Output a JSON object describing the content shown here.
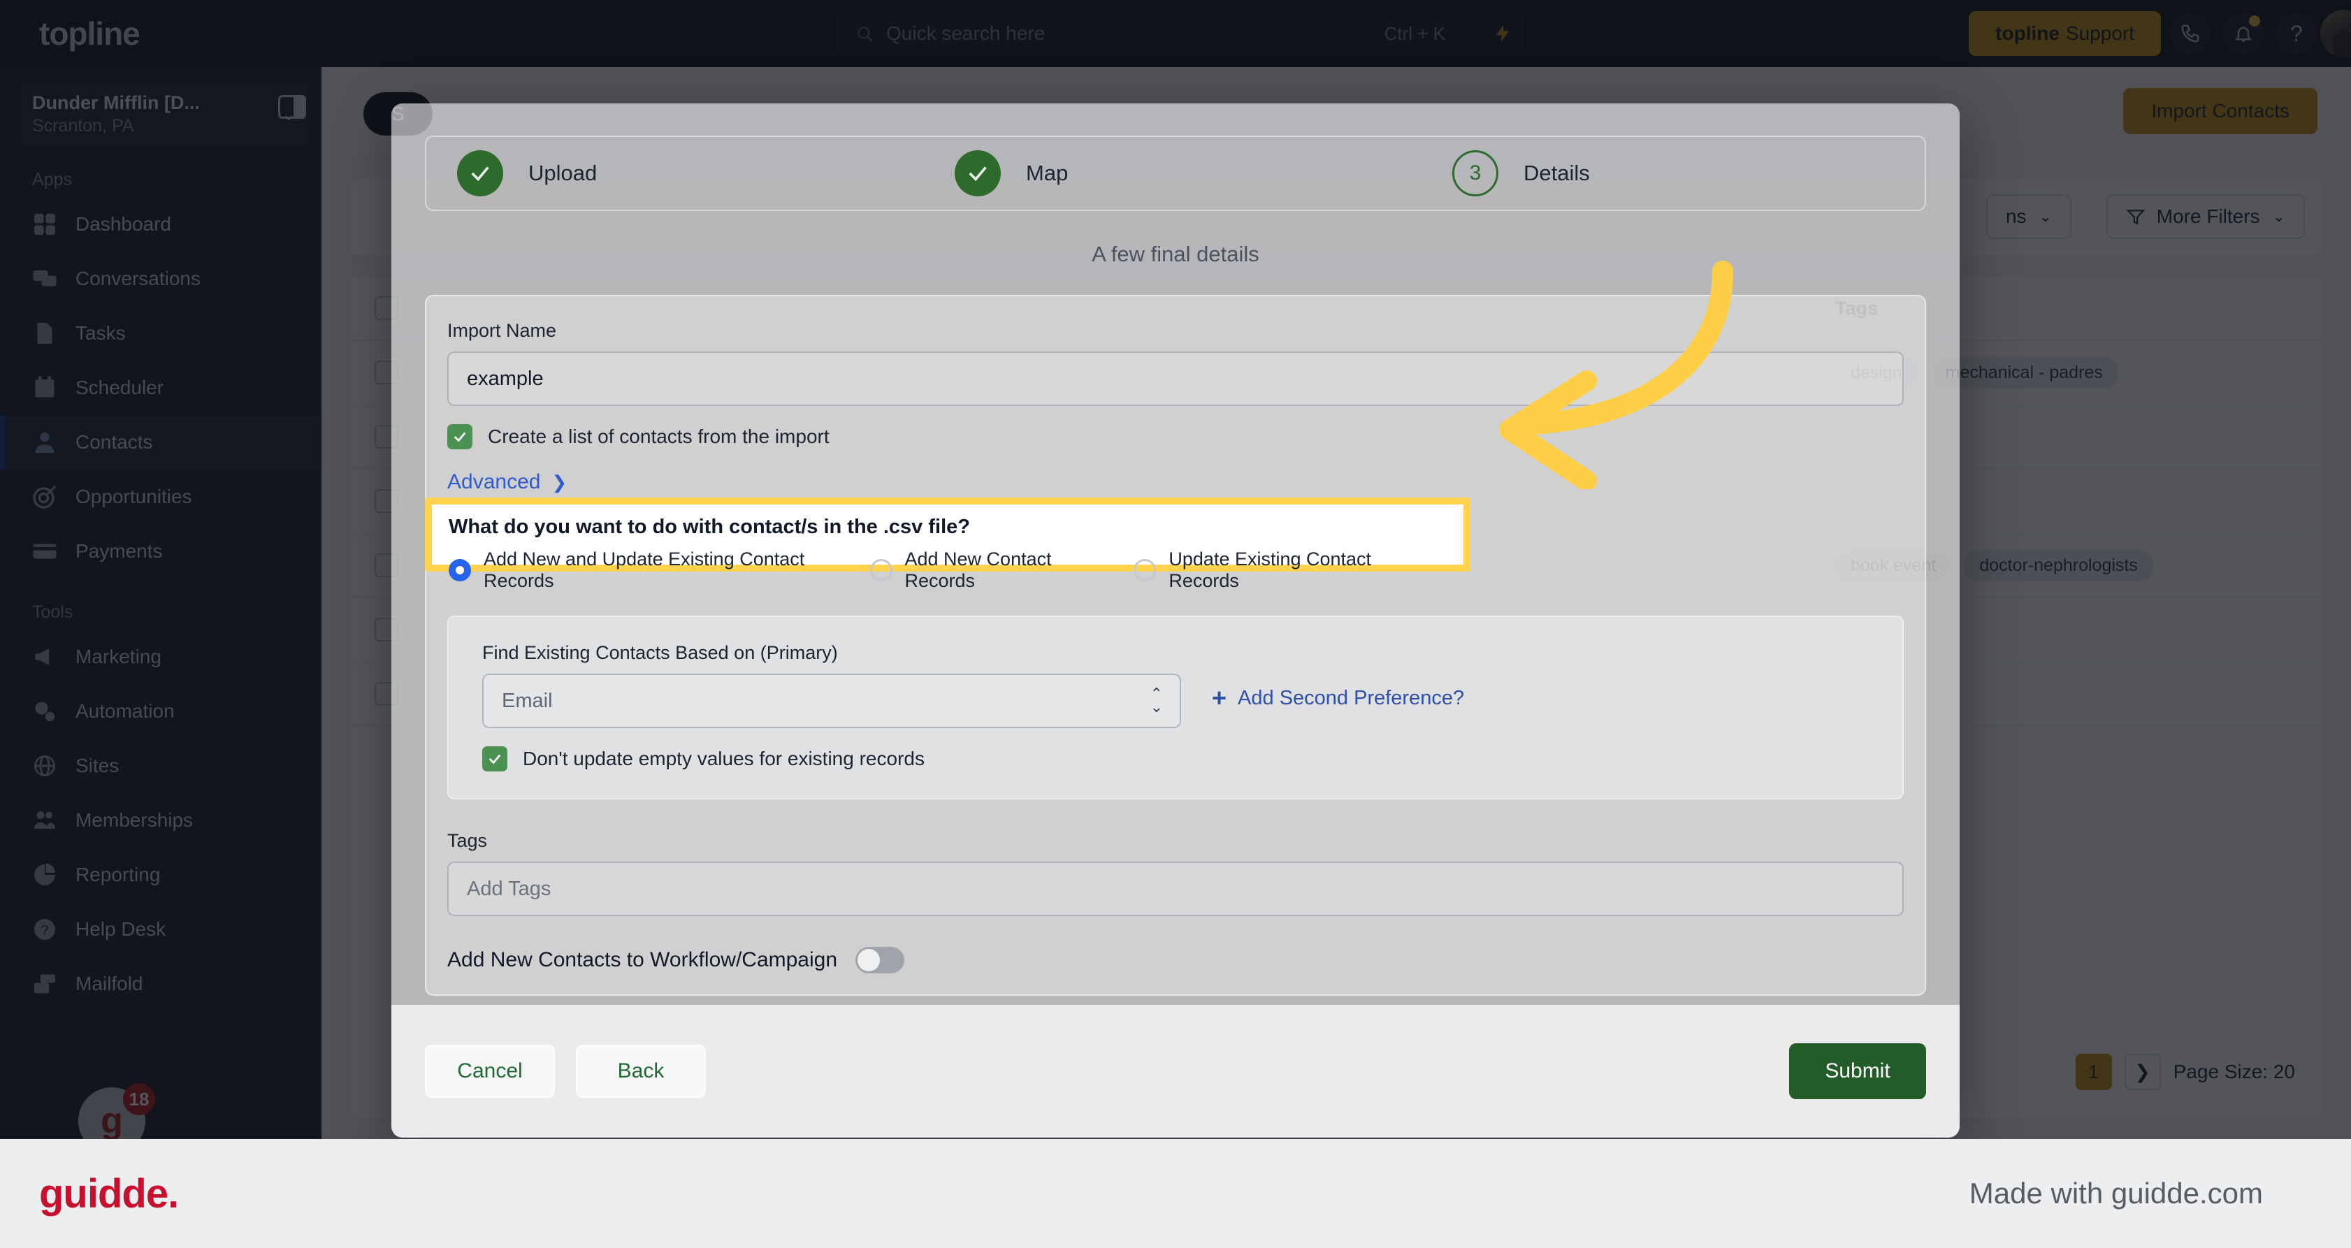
{
  "topbar": {
    "logo": "topline",
    "search_placeholder": "Quick search here",
    "search_shortcut": "Ctrl + K",
    "bolt_icon": "lightning-bolt-icon",
    "support_brand": "topline",
    "support_label": "Support",
    "phone_icon": "phone-icon",
    "bell_icon": "bell-icon",
    "help_label": "?",
    "avatar": "user-avatar"
  },
  "sidebar": {
    "workspace_name": "Dunder Mifflin [D...",
    "workspace_location": "Scranton, PA",
    "panel_toggle_icon": "panel-toggle-icon",
    "sections": [
      {
        "label": "Apps",
        "items": [
          {
            "label": "Dashboard",
            "icon": "dashboard-icon"
          },
          {
            "label": "Conversations",
            "icon": "chat-icon"
          },
          {
            "label": "Tasks",
            "icon": "task-icon"
          },
          {
            "label": "Scheduler",
            "icon": "calendar-icon"
          },
          {
            "label": "Contacts",
            "icon": "person-icon",
            "active": true
          },
          {
            "label": "Opportunities",
            "icon": "target-icon"
          },
          {
            "label": "Payments",
            "icon": "card-icon"
          }
        ]
      },
      {
        "label": "Tools",
        "items": [
          {
            "label": "Marketing",
            "icon": "megaphone-icon"
          },
          {
            "label": "Automation",
            "icon": "gears-icon"
          },
          {
            "label": "Sites",
            "icon": "globe-icon"
          },
          {
            "label": "Memberships",
            "icon": "people-icon"
          },
          {
            "label": "Reporting",
            "icon": "pie-chart-icon"
          },
          {
            "label": "Help Desk",
            "icon": "question-circle-icon"
          },
          {
            "label": "Mailfold",
            "icon": "mail-icon"
          }
        ]
      }
    ],
    "chat_glyph": "g",
    "chat_badge": "18"
  },
  "page": {
    "smart_pill": "S",
    "import_button": "Import Contacts",
    "columns_button": "ns",
    "more_filters_button": "More Filters",
    "funnel_icon": "funnel-icon",
    "chevron_icon": "chevron-down-icon",
    "table_header_tags": "Tags",
    "tag_chips": [
      "design",
      "mechanical - padres",
      "book event",
      "doctor-nephrologists"
    ],
    "page_number": "1",
    "next_page_icon": "chevron-right-icon",
    "page_size": "Page Size: 20"
  },
  "modal": {
    "steps": [
      {
        "label": "Upload",
        "state": "done",
        "icon": "check-icon"
      },
      {
        "label": "Map",
        "state": "done",
        "icon": "check-icon"
      },
      {
        "label": "Details",
        "state": "current",
        "number": "3"
      }
    ],
    "subtitle": "A few final details",
    "import_name_label": "Import Name",
    "import_name_value": "example",
    "create_list_label": "Create a list of contacts from the import",
    "create_list_checked": true,
    "advanced_label": "Advanced",
    "advanced_chevron": "chevron-right-icon",
    "highlight": {
      "question": "What do you want to do with contact/s in the .csv file?",
      "options": [
        {
          "label": "Add New and Update Existing Contact Records",
          "selected": true
        },
        {
          "label": "Add New Contact Records",
          "selected": false
        },
        {
          "label": "Update Existing Contact Records",
          "selected": false
        }
      ],
      "border_color": "#ffd34d"
    },
    "find_label": "Find Existing Contacts Based on (Primary)",
    "find_value": "Email",
    "add_pref_label": "Add Second Preference?",
    "dont_update_label": "Don't update empty values for existing records",
    "dont_update_checked": true,
    "tags_label": "Tags",
    "tags_placeholder": "Add Tags",
    "workflow_label": "Add New Contacts to Workflow/Campaign",
    "workflow_on": false,
    "cancel_label": "Cancel",
    "back_label": "Back",
    "submit_label": "Submit",
    "accent_green": "#235c28",
    "accent_blue": "#2563eb"
  },
  "annotation": {
    "arrow": "curved-arrow-left",
    "color": "#ffce47"
  },
  "guidde": {
    "logo": "guidde.",
    "made_with": "Made with guidde.com",
    "brand_color": "#c8102e"
  }
}
